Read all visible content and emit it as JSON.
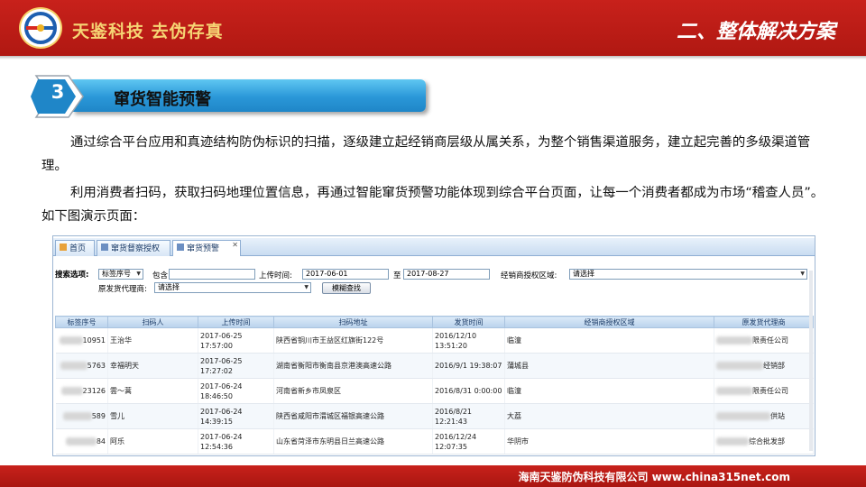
{
  "header": {
    "brand": "天鉴科技 去伪存真",
    "section_title": "二、整体解决方案"
  },
  "heading": {
    "number": "3",
    "title": "窜货智能预警"
  },
  "paragraphs": {
    "p1": "通过综合平台应用和真迹结构防伪标识的扫描，逐级建立起经销商层级从属关系，为整个销售渠道服务，建立起完善的多级渠道管理。",
    "p2": "利用消费者扫码，获取扫码地理位置信息，再通过智能窜货预警功能体现到综合平台页面，让每一个消费者都成为市场“稽查人员”。如下图演示页面："
  },
  "app": {
    "tabs": [
      "首页",
      "窜货督察授权",
      "窜货预警"
    ],
    "filter": {
      "label_search": "搜索选项:",
      "field_select": "标签序号",
      "contains_label": "包含",
      "contains_value": "",
      "upload_time_label": "上传时间:",
      "date_from": "2017-06-01",
      "to_label": "至",
      "date_to": "2017-08-27",
      "region_label": "经销商授权区域:",
      "region_value": "请选择",
      "source_agent_label": "原发货代理商:",
      "source_agent_value": "请选择",
      "fuzzy_button": "模糊查找"
    },
    "columns": [
      "标签序号",
      "扫码人",
      "上传时间",
      "扫码地址",
      "发货时间",
      "经销商授权区域",
      "原发货代理商"
    ],
    "rows": [
      {
        "id": "10951",
        "scanner": "王治华",
        "upload": "2017-06-25 17:57:00",
        "address": "陕西省铜川市王益区红旗街122号",
        "ship": "2016/12/10 13:51:20",
        "region": "临潼",
        "agent": "限责任公司"
      },
      {
        "id": "5763",
        "scanner": "幸福明天",
        "upload": "2017-06-25 17:27:02",
        "address": "湖南省衡阳市衡南县京港澳高速公路",
        "ship": "2016/9/1 19:38:07",
        "region": "蒲城县",
        "agent": "经销部"
      },
      {
        "id": "23126",
        "scanner": "雲～蒿",
        "upload": "2017-06-24 18:46:50",
        "address": "河南省新乡市凤泉区",
        "ship": "2016/8/31 0:00:00",
        "region": "临潼",
        "agent": "限责任公司"
      },
      {
        "id": "589",
        "scanner": "雪儿",
        "upload": "2017-06-24 14:39:15",
        "address": "陕西省咸阳市渭城区福银高速公路",
        "ship": "2016/8/21 12:21:43",
        "region": "大荔",
        "agent": "供站"
      },
      {
        "id": "84",
        "scanner": "阿乐",
        "upload": "2017-06-24 12:54:36",
        "address": "山东省菏泽市东明县日兰高速公路",
        "ship": "2016/12/24 12:07:35",
        "region": "华阴市",
        "agent": "综合批发部"
      }
    ]
  },
  "footer": {
    "text": "海南天鉴防伪科技有限公司   www.china315net.com"
  },
  "colors": {
    "banner_red": "#c8211b",
    "brand_gold": "#f6d574",
    "heading_blue": "#2a97d8",
    "link_red": "#d22020",
    "link_blue": "#1d4fa3"
  }
}
